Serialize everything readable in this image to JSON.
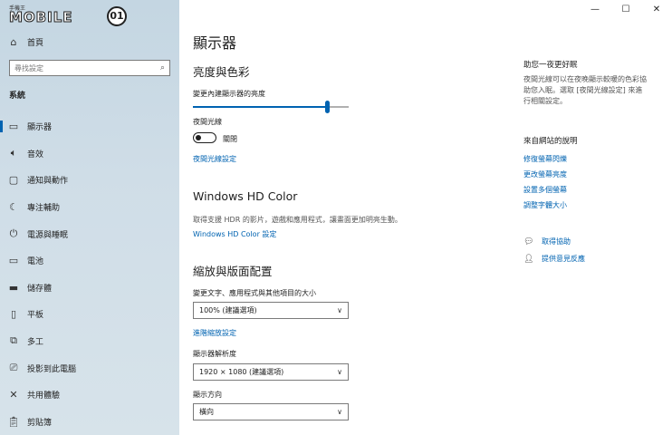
{
  "watermark": {
    "small": "手機王",
    "brand": "MOBILE",
    "badge": "01"
  },
  "sidebar": {
    "home": {
      "icon": "home-icon",
      "label": "首頁"
    },
    "search": {
      "placeholder": "尋找設定"
    },
    "section": "系統",
    "items": [
      {
        "icon": "display-icon",
        "label": "顯示器",
        "active": true
      },
      {
        "icon": "sound-icon",
        "label": "音效"
      },
      {
        "icon": "notification-icon",
        "label": "通知與動作"
      },
      {
        "icon": "focus-assist-icon",
        "label": "專注輔助"
      },
      {
        "icon": "power-icon",
        "label": "電源與睡眠"
      },
      {
        "icon": "battery-icon",
        "label": "電池"
      },
      {
        "icon": "storage-icon",
        "label": "儲存體"
      },
      {
        "icon": "tablet-icon",
        "label": "平板"
      },
      {
        "icon": "multitasking-icon",
        "label": "多工"
      },
      {
        "icon": "project-icon",
        "label": "投影到此電腦"
      },
      {
        "icon": "shared-experiences-icon",
        "label": "共用體驗"
      },
      {
        "icon": "clipboard-icon",
        "label": "剪貼簿"
      }
    ]
  },
  "window_controls": {
    "minimize": "—",
    "maximize": "☐",
    "close": "✕"
  },
  "main": {
    "title": "顯示器",
    "brightness": {
      "heading": "亮度與色彩",
      "slider_label": "變更內建顯示器的亮度",
      "slider_value": 0.86,
      "night_light_label": "夜間光線",
      "night_light_state": "關閉",
      "night_light_settings": "夜間光線設定"
    },
    "hdr": {
      "heading": "Windows HD Color",
      "description": "取得支援 HDR 的影片，遊戲和應用程式，讓畫面更加明亮生動。",
      "link": "Windows HD Color 設定"
    },
    "scale": {
      "heading": "縮放與版面配置",
      "scale_label": "變更文字、應用程式與其他項目的大小",
      "scale_value": "100% (建議選項)",
      "advanced_link": "進階縮放設定",
      "resolution_label": "顯示器解析度",
      "resolution_value": "1920 × 1080 (建議選項)",
      "orientation_label": "顯示方向",
      "orientation_value": "橫向"
    }
  },
  "right": {
    "tip_title": "助您一夜更好眠",
    "tip_body_1": "夜間光線可以在夜晚顯示較暖的色彩協",
    "tip_body_2": "助您入眠。選取 [夜間光線設定] 來進",
    "tip_body_3": "行相關設定。",
    "web_help_title": "來自網站的說明",
    "web_links": [
      "修復螢幕閃爍",
      "更改螢幕亮度",
      "設置多個螢幕",
      "調整字體大小"
    ],
    "get_help": "取得協助",
    "feedback": "提供意見反應"
  }
}
